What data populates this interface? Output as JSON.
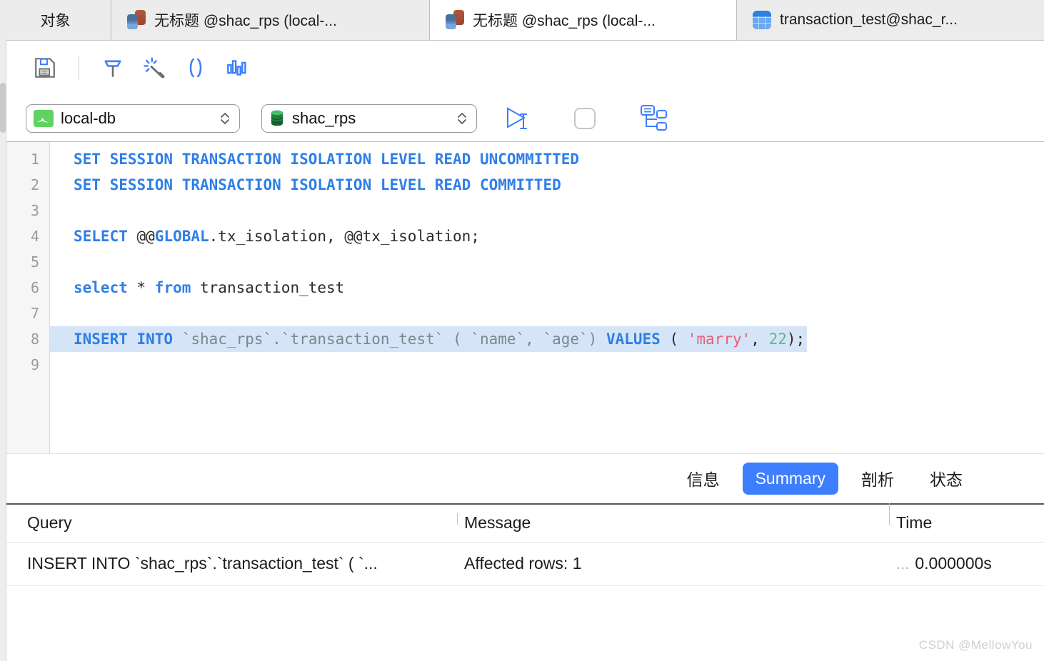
{
  "tabs": [
    {
      "label": "对象",
      "icon": "none",
      "active": false
    },
    {
      "label": "无标题 @shac_rps (local-...",
      "icon": "query-icon",
      "active": false
    },
    {
      "label": "无标题 @shac_rps (local-...",
      "icon": "query-icon",
      "active": true
    },
    {
      "label": "transaction_test@shac_r...",
      "icon": "table-icon",
      "active": false
    }
  ],
  "toolbar": {
    "save": "save-icon",
    "build": "build-icon",
    "beautify": "beautify-icon",
    "parens": "parentheses-icon",
    "explain": "explain-icon"
  },
  "connection": {
    "server_value": "local-db",
    "database_value": "shac_rps",
    "run_label": "run-icon",
    "stop_label": "stop-icon",
    "plan_label": "explain-plan-icon"
  },
  "editor": {
    "line_numbers": [
      "1",
      "2",
      "3",
      "4",
      "5",
      "6",
      "7",
      "8",
      "9"
    ],
    "lines": [
      {
        "n": 1,
        "text": "SET SESSION TRANSACTION ISOLATION LEVEL READ UNCOMMITTED"
      },
      {
        "n": 2,
        "text": "SET SESSION TRANSACTION ISOLATION LEVEL READ COMMITTED"
      },
      {
        "n": 3,
        "text": ""
      },
      {
        "n": 4,
        "text": "SELECT @@GLOBAL.tx_isolation, @@tx_isolation;"
      },
      {
        "n": 5,
        "text": ""
      },
      {
        "n": 6,
        "text": "select * from transaction_test"
      },
      {
        "n": 7,
        "text": ""
      },
      {
        "n": 8,
        "text": "INSERT INTO `shac_rps`.`transaction_test` ( `name`, `age`) VALUES ( 'marry', 22);"
      },
      {
        "n": 9,
        "text": ""
      }
    ],
    "l1_kw": "SET SESSION TRANSACTION ISOLATION LEVEL READ UNCOMMITTED",
    "l2_kw": "SET SESSION TRANSACTION ISOLATION LEVEL READ COMMITTED",
    "l4_a": "SELECT",
    "l4_b": " @@",
    "l4_c": "GLOBAL",
    "l4_d": ".tx_isolation, @@tx_isolation;",
    "l6_a": "select",
    "l6_b": " * ",
    "l6_c": "from",
    "l6_d": " transaction_test",
    "l8_a": "INSERT INTO",
    "l8_b": " `shac_rps`.`transaction_test`",
    "l8_c": " ( `name`, `age`) ",
    "l8_d": "VALUES",
    "l8_e": " ( ",
    "l8_f": "'marry'",
    "l8_g": ", ",
    "l8_h": "22",
    "l8_i": ");"
  },
  "result_tabs": [
    {
      "label": "信息",
      "active": false
    },
    {
      "label": "Summary",
      "active": true
    },
    {
      "label": "剖析",
      "active": false
    },
    {
      "label": "状态",
      "active": false
    }
  ],
  "result_table": {
    "columns": [
      "Query",
      "Message",
      "Time"
    ],
    "rows": [
      {
        "query": "INSERT INTO `shac_rps`.`transaction_test` ( `...",
        "message": "Affected rows: 1",
        "message_ellipsis": "...",
        "time": "0.000000s",
        "time_ellipsis": "..."
      }
    ]
  },
  "watermark": "CSDN @MellowYou",
  "colors": {
    "accent": "#3d7eff",
    "keyword": "#2f7fe6",
    "string": "#e2607a",
    "number": "#5bb98c",
    "identifier": "#7d8791",
    "selection": "#d6e4f7",
    "tabbar_bg": "#ededed"
  }
}
